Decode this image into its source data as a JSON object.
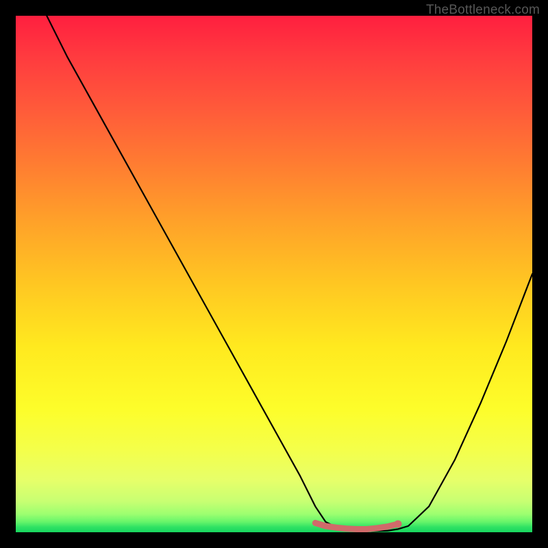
{
  "watermark": "TheBottleneck.com",
  "chart_data": {
    "type": "line",
    "title": "",
    "xlabel": "",
    "ylabel": "",
    "xlim": [
      0,
      100
    ],
    "ylim": [
      0,
      100
    ],
    "grid": false,
    "series": [
      {
        "name": "bottleneck-curve",
        "x": [
          6,
          10,
          15,
          20,
          25,
          30,
          35,
          40,
          45,
          50,
          55,
          58,
          60,
          62,
          65,
          68,
          72,
          74,
          76,
          80,
          85,
          90,
          95,
          100
        ],
        "y": [
          100,
          92,
          83,
          74,
          65,
          56,
          47,
          38,
          29,
          20,
          11,
          5,
          2,
          1,
          0.4,
          0.2,
          0.3,
          0.6,
          1.2,
          5,
          14,
          25,
          37,
          50
        ],
        "color": "#000000"
      },
      {
        "name": "optimal-range-marker",
        "x": [
          58,
          60,
          62,
          64,
          66,
          68,
          70,
          72,
          74
        ],
        "y": [
          1.8,
          1.2,
          0.9,
          0.7,
          0.6,
          0.6,
          0.8,
          1.1,
          1.6
        ],
        "color": "#d06a6a"
      }
    ],
    "points": [
      {
        "name": "optimal-end-dot",
        "x": 74,
        "y": 1.6,
        "color": "#d06a6a"
      }
    ]
  }
}
